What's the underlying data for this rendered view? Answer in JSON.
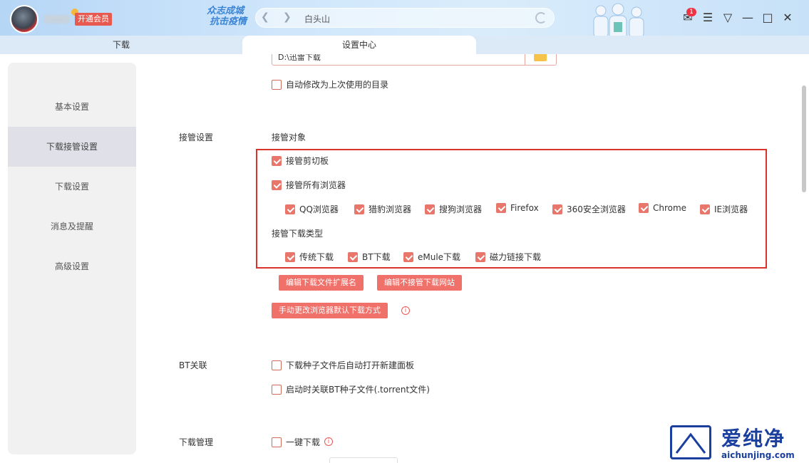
{
  "titlebar": {
    "vip_label": "开通会员",
    "slogan_line1": "众志成城",
    "slogan_line2": "抗击疫情",
    "address_text": "白头山",
    "message_count": "1"
  },
  "tabs": [
    {
      "label": "下载"
    },
    {
      "label": "设置中心"
    }
  ],
  "sidebar": {
    "items": [
      {
        "label": "基本设置"
      },
      {
        "label": "下载接管设置"
      },
      {
        "label": "下载设置"
      },
      {
        "label": "消息及提醒"
      },
      {
        "label": "高级设置"
      }
    ]
  },
  "content": {
    "path_value": "D:\\迅雷下载",
    "auto_modify_label": "自动修改为上次使用的目录",
    "takeover_section": "接管设置",
    "takeover_target_label": "接管对象",
    "clipboard_label": "接管剪切板",
    "all_browsers_label": "接管所有浏览器",
    "browsers": [
      "QQ浏览器",
      "猎豹浏览器",
      "搜狗浏览器",
      "Firefox",
      "360安全浏览器",
      "Chrome",
      "IE浏览器"
    ],
    "download_type_label": "接管下载类型",
    "download_types": [
      "传统下载",
      "BT下载",
      "eMule下载",
      "磁力链接下载"
    ],
    "btn_edit_ext": "编辑下载文件扩展名",
    "btn_edit_sites": "编辑不接管下载网站",
    "btn_manual_browser": "手动更改浏览器默认下载方式",
    "bt_section": "BT关联",
    "bt_option1": "下载种子文件后自动打开新建面板",
    "bt_option2": "启动时关联BT种子文件(.torrent文件)",
    "manage_section": "下载管理",
    "one_click_label": "一键下载"
  },
  "watermark": {
    "text": "爱纯净",
    "url": "aichunjing.com"
  },
  "colors": {
    "accent": "#e8766a",
    "highlight_border": "#d9332c",
    "brand_blue": "#1a3f9e"
  }
}
